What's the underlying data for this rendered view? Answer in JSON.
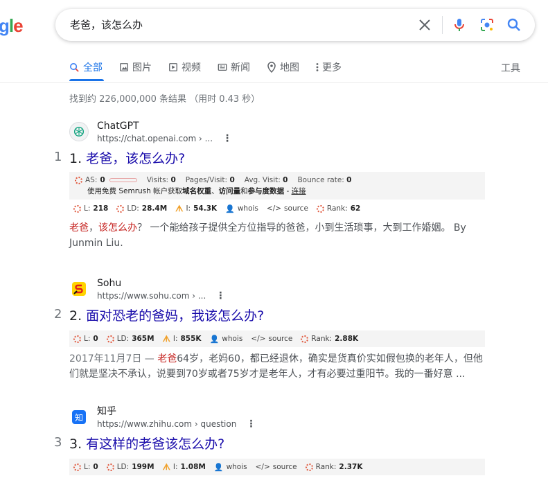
{
  "logo": {
    "part1": "g",
    "part2": "l",
    "part3": "e"
  },
  "search": {
    "query": "老爸，该怎么办"
  },
  "tabs": [
    {
      "label": "全部",
      "icon": "search-icon"
    },
    {
      "label": "图片",
      "icon": "image-icon"
    },
    {
      "label": "视频",
      "icon": "play-icon"
    },
    {
      "label": "新闻",
      "icon": "news-icon"
    },
    {
      "label": "地图",
      "icon": "map-pin-icon"
    },
    {
      "label": "更多",
      "icon": "more-vert-icon"
    }
  ],
  "tools_label": "工具",
  "stats": "找到约 226,000,000 条结果 （用时 0.43 秒）",
  "results": [
    {
      "rank": "1",
      "site_name": "ChatGPT",
      "url": "https://chat.openai.com › ...",
      "title_num": "1. ",
      "title": "老爸，该怎么办?",
      "semrush": {
        "as_label": "AS:",
        "as_value": "0",
        "visits_label": "Visits:",
        "visits_value": "0",
        "pages_label": "Pages/Visit:",
        "pages_value": "0",
        "avg_label": "Avg. Visit:",
        "avg_value": "0",
        "bounce_label": "Bounce rate:",
        "bounce_value": "0",
        "promo_prefix": "使用免费 Semrush 帐户获取",
        "promo_bold1": "域名权重",
        "promo_sep1": "、",
        "promo_bold2": "访问量",
        "promo_sep2": "和",
        "promo_bold3": "参与度数据",
        "promo_sep3": " - ",
        "promo_link": "连接"
      },
      "metrics": {
        "l": "218",
        "ld": "28.4M",
        "i": "54.3K",
        "whois": "whois",
        "source": "source",
        "rank": "62"
      },
      "snippet": {
        "hl1": "老爸",
        "sep": "，",
        "hl2": "该怎么办",
        "rest": "？ 一个能给孩子提供全方位指导的爸爸，小到生活琐事，大到工作婚姻。 By Junmin Liu."
      }
    },
    {
      "rank": "2",
      "site_name": "Sohu",
      "url": "https://www.sohu.com › ...",
      "title_num": "2. ",
      "title": "面对恐老的爸妈，我该怎么办?",
      "metrics": {
        "l": "0",
        "ld": "365M",
        "i": "855K",
        "whois": "whois",
        "source": "source",
        "rank": "2.88K"
      },
      "snippet": {
        "date": "2017年11月7日 — ",
        "hl1": "老爸",
        "rest": "64岁，老妈60，都已经退休，确实是货真价实如假包换的老年人，但他们就是坚决不承认，说要到70岁或者75岁才是老年人，才有必要过重阳节。我的一番好意 ..."
      }
    },
    {
      "rank": "3",
      "site_name": "知乎",
      "url": "https://www.zhihu.com › question",
      "title_num": "3. ",
      "title": "有这样的老爸该怎么办?",
      "metrics": {
        "l": "0",
        "ld": "199M",
        "i": "1.08M",
        "whois": "whois",
        "source": "source",
        "rank": "2.37K"
      }
    }
  ],
  "metric_labels": {
    "l": "L:",
    "ld": "LD:",
    "i": "I:",
    "rank": "Rank:"
  },
  "colors": {
    "link": "#1a0dab",
    "accent": "#1a73e8",
    "highlight": "#c5221f"
  }
}
